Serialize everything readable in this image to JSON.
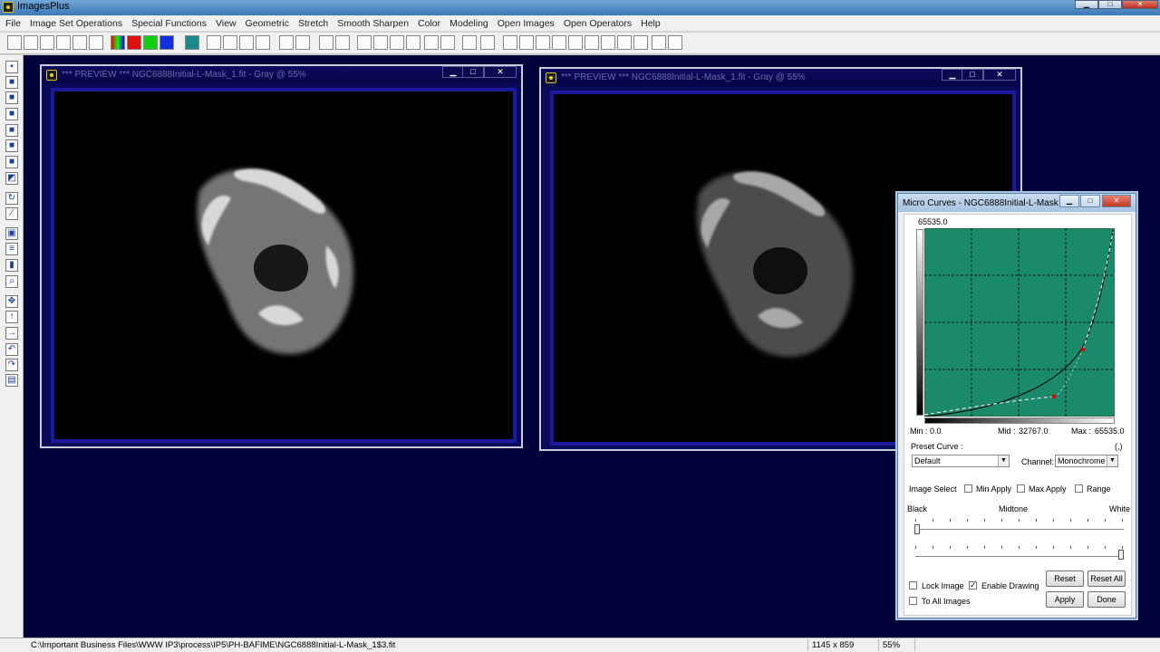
{
  "app": {
    "title": "ImagesPlus",
    "min_glyph": "▁",
    "max_glyph": "□",
    "close_glyph": "✕"
  },
  "menu": [
    "File",
    "Image Set Operations",
    "Special Functions",
    "View",
    "Geometric",
    "Stretch",
    "Smooth Sharpen",
    "Color",
    "Modeling",
    "Open Images",
    "Open Operators",
    "Help"
  ],
  "toolbar": {
    "icons": [
      "new-file-icon",
      "open-folder-icon",
      "save-icon",
      "close-red-x-icon",
      "close-green-x-icon",
      "copy-icon",
      "color-bars-icon",
      "red-channel-icon",
      "green-channel-icon",
      "blue-channel-icon",
      "grid-icon",
      "undo-icon",
      "redo-icon",
      "undo-red-icon",
      "redo-red-icon",
      "circle-target-icon",
      "circle-red-icon",
      "dots-icon",
      "coordinate-icon",
      "triangle-blue-icon",
      "corner-axis-icon",
      "plus-green-icon",
      "crosshair-icon",
      "select-box-icon",
      "paint-icon",
      "pencil-icon",
      "table-icon",
      "zoom-in-icon",
      "zoom-out-icon",
      "zoom-fit-icon",
      "zoom-actual-icon",
      "add-red-icon",
      "minus-red-icon",
      "rect1-icon",
      "rect2-icon",
      "rect3-icon",
      "square-small-icon",
      "square-dot-icon"
    ]
  },
  "lefttoolbar": {
    "icons": [
      "save-small-icon",
      "black-square-icon",
      "red-black-icon",
      "green-black-icon",
      "blue-black-icon",
      "blue2-black-icon",
      "cyan-black-icon",
      "black-white-icon",
      "refresh-gray-icon",
      "pencil-slash-icon",
      "target-box-icon",
      "bars-icon",
      "black-bar-icon",
      "zoom-red-icon",
      "move-cross-icon",
      "arrow-up-icon",
      "arrow-right-icon",
      "rotate-left-icon",
      "rotate-down-icon",
      "page-icon"
    ],
    "glyphs": [
      "▪",
      "■",
      "■",
      "■",
      "■",
      "■",
      "■",
      "◩",
      "↻",
      "⁄",
      "▣",
      "≡",
      "▮",
      "⌕",
      "✥",
      "↑",
      "→",
      "↶",
      "↷",
      "▤"
    ]
  },
  "windows": [
    {
      "title": "*** PREVIEW *** NGC6888Initial-L-Mask_1.fit - Gray @ 55%"
    },
    {
      "title": "*** PREVIEW *** NGC6888Initial-L-Mask_1.fit - Gray @ 55%"
    }
  ],
  "dialog": {
    "title": "Micro Curves - NGC6888Initial-L-Mask...",
    "top_value": "65535.0",
    "min_label": "Min :",
    "min_value": "0.0",
    "mid_label": "Mid :",
    "mid_value": "32767.0",
    "max_label": "Max :",
    "max_value": "65535.0",
    "preset_label": "Preset Curve :",
    "preset_extra": "(,)",
    "preset_value": "Default",
    "channel_label": "Channel:",
    "channel_value": "Monochrome",
    "image_select_label": "Image Select",
    "min_apply_label": "Min Apply",
    "max_apply_label": "Max Apply",
    "range_label": "Range",
    "black_label": "Black",
    "midtone_label": "Midtone",
    "white_label": "White",
    "reset_label": "Reset",
    "reset_all_label": "Reset All",
    "lock_image_label": "Lock Image",
    "enable_drawing_label": "Enable Drawing",
    "enable_drawing_checked": true,
    "to_all_images_label": "To All Images",
    "apply_label": "Apply",
    "done_label": "Done",
    "check_glyph": "✓",
    "arrow_glyph": "▼",
    "curve_color": "#1a8a6a"
  },
  "statusbar": {
    "path": "C:\\Important Business Files\\WWW IP3\\process\\IP5\\PH-BAFIME\\NGC6888Initial-L-Mask_1$3.fit",
    "dimensions": "1145 x 859",
    "zoom": "55%"
  }
}
